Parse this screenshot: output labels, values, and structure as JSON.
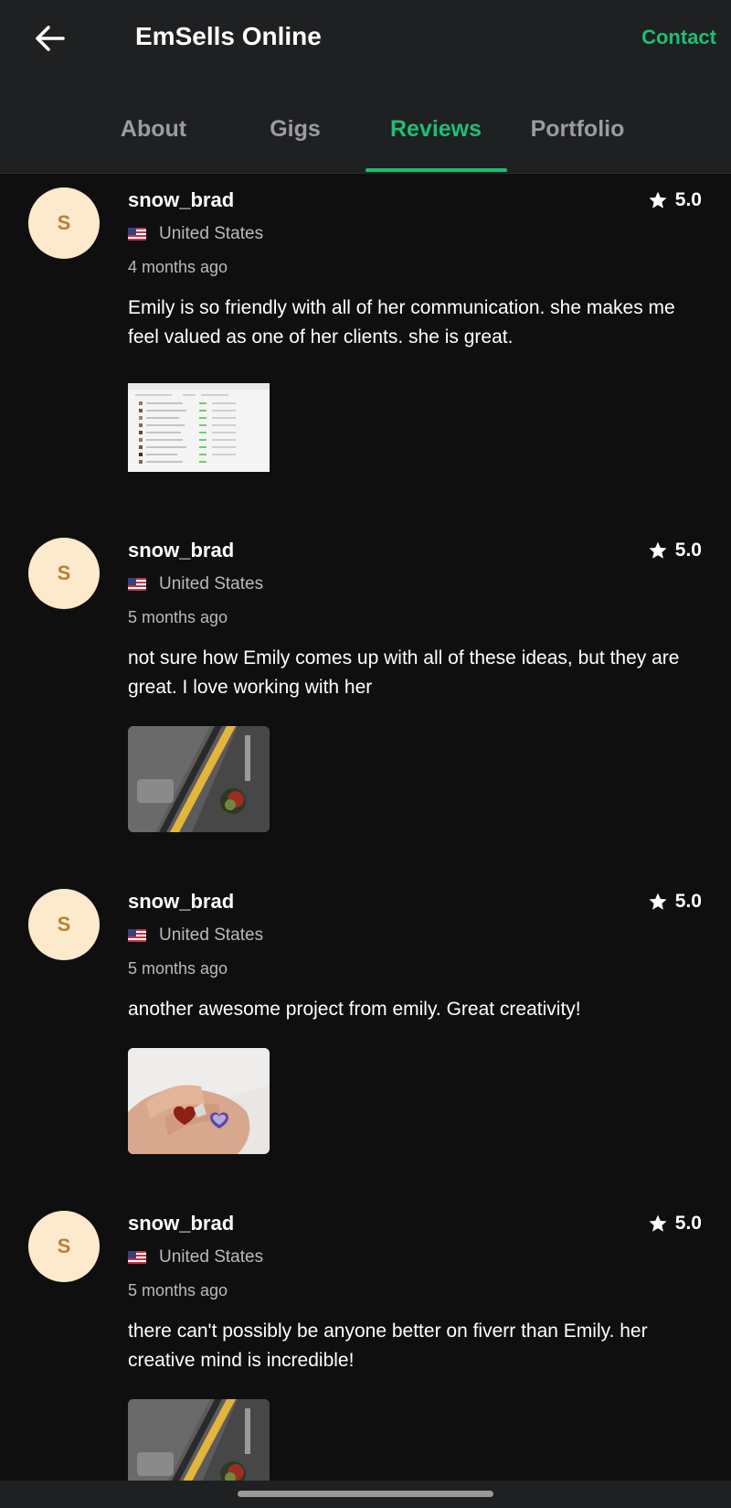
{
  "header": {
    "title": "EmSells Online",
    "contact_label": "Contact",
    "back_icon": "arrow-left-icon"
  },
  "tabs": [
    {
      "label": "About",
      "active": false
    },
    {
      "label": "Gigs",
      "active": false
    },
    {
      "label": "Reviews",
      "active": true
    },
    {
      "label": "Portfolio",
      "active": false
    }
  ],
  "colors": {
    "accent": "#1dbf73",
    "background": "#0f0f10",
    "header_background": "#1f2022",
    "avatar_background": "#fde9cc",
    "avatar_letter": "#b3813a"
  },
  "reviews": [
    {
      "avatar_letter": "S",
      "username": "snow_brad",
      "rating": "5.0",
      "country": "United States",
      "time": "4 months ago",
      "text": "Emily is so friendly with all of her communication. she makes me feel valued as one of her clients. she is great.",
      "thumbnail": "spreadsheet-screenshot"
    },
    {
      "avatar_letter": "S",
      "username": "snow_brad",
      "rating": "5.0",
      "country": "United States",
      "time": "5 months ago",
      "text": "not sure how Emily comes up with all of these ideas, but they are great. I love working with her",
      "thumbnail": "product-photo-yellow-stripe"
    },
    {
      "avatar_letter": "S",
      "username": "snow_brad",
      "rating": "5.0",
      "country": "United States",
      "time": "5 months ago",
      "text": "another awesome project from emily. Great creativity!",
      "thumbnail": "heart-rings-photo"
    },
    {
      "avatar_letter": "S",
      "username": "snow_brad",
      "rating": "5.0",
      "country": "United States",
      "time": "5 months ago",
      "text": "there can't possibly be anyone better on fiverr than Emily. her creative mind is incredible!",
      "thumbnail": "product-photo-yellow-stripe"
    }
  ]
}
